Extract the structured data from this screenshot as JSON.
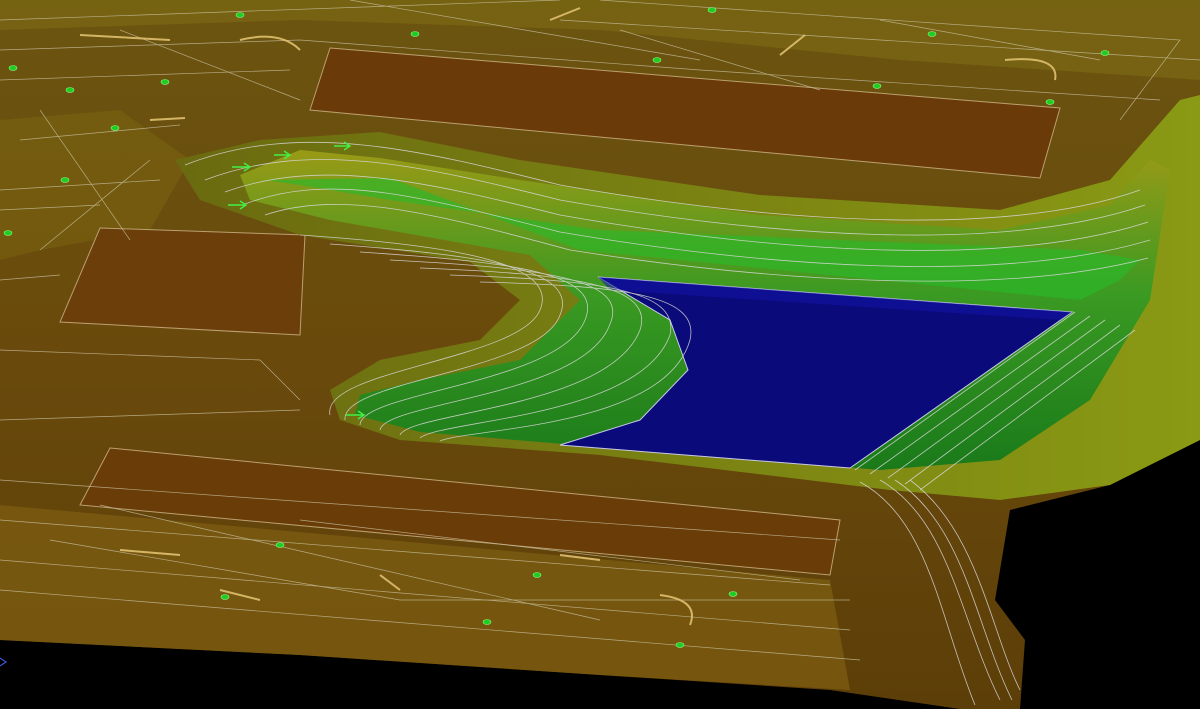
{
  "viewport": {
    "colors": {
      "background": "#000000",
      "grade_high": "#5a3a08",
      "grade_mid": "#7a5a10",
      "grade_ridge": "#9a8a12",
      "slope_yellow": "#a8a818",
      "slope_green": "#1e8a1e",
      "slope_bright": "#2fbf2f",
      "pond_bottom": "#0a0a78",
      "contour": "#d8d8d8",
      "marker": "#22cc22"
    },
    "icons": [
      "grade-marker-icon",
      "flow-arrow-icon"
    ]
  }
}
